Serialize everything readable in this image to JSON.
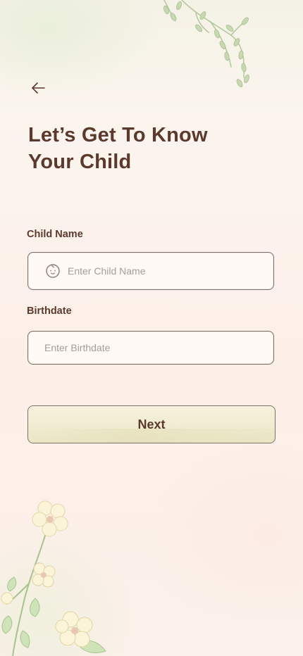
{
  "header": {
    "back_icon": "arrow-left-icon",
    "title": "Let’s Get To Know Your Child"
  },
  "form": {
    "child_name": {
      "label": "Child Name",
      "placeholder": "Enter Child Name",
      "value": "",
      "icon": "child-face-icon"
    },
    "birthdate": {
      "label": "Birthdate",
      "placeholder": "Enter Birthdate",
      "value": ""
    }
  },
  "actions": {
    "next_label": "Next"
  },
  "colors": {
    "text_primary": "#5b3a2d",
    "placeholder": "#a59d97",
    "border": "#7d716a",
    "button_fill": "#f0ecd0",
    "background": "#fcefe8"
  }
}
